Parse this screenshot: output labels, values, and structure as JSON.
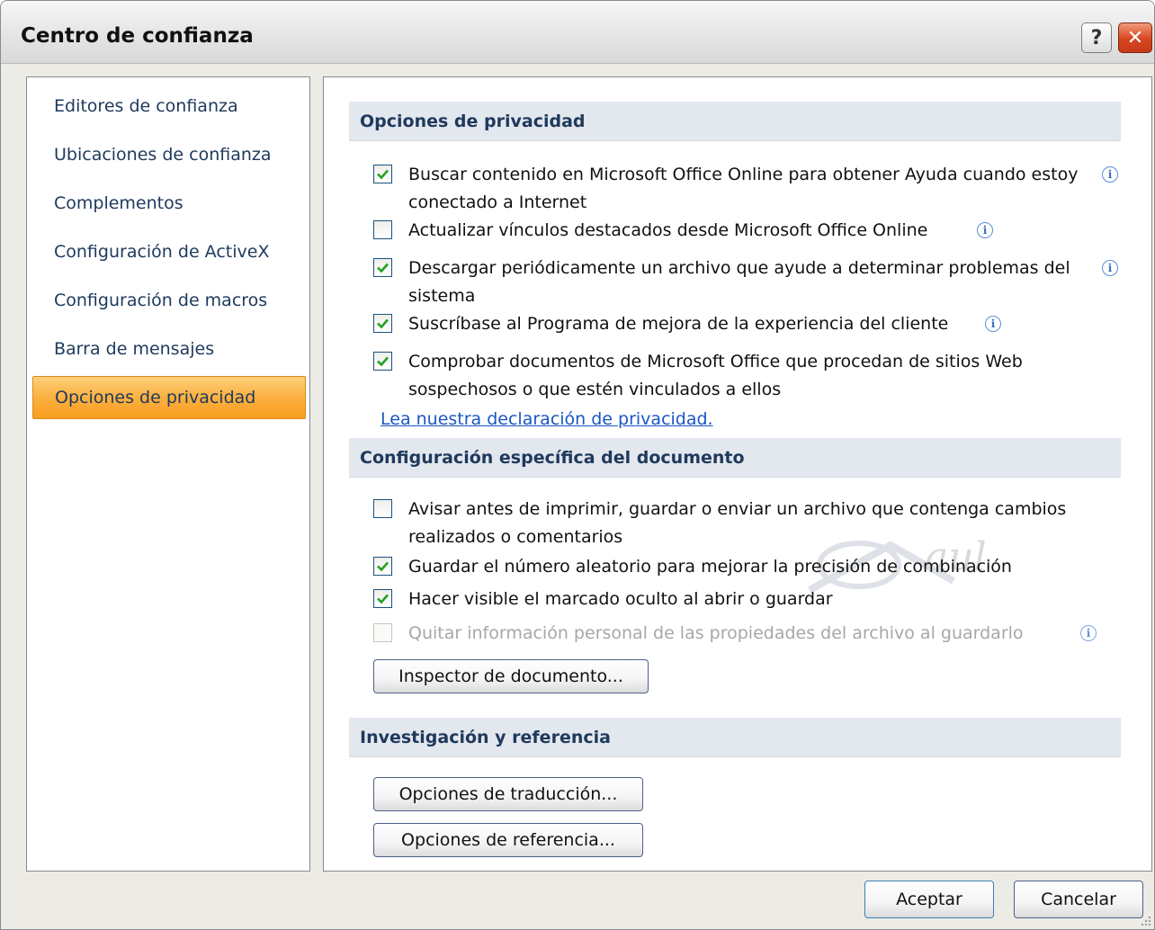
{
  "window": {
    "title": "Centro de confianza",
    "help_label": "?",
    "close_label": "✕"
  },
  "nav": {
    "items": [
      {
        "label": "Editores de confianza",
        "selected": false
      },
      {
        "label": "Ubicaciones de confianza",
        "selected": false
      },
      {
        "label": "Complementos",
        "selected": false
      },
      {
        "label": "Configuración de ActiveX",
        "selected": false
      },
      {
        "label": "Configuración de macros",
        "selected": false
      },
      {
        "label": "Barra de mensajes",
        "selected": false
      },
      {
        "label": "Opciones de privacidad",
        "selected": true
      }
    ]
  },
  "privacy": {
    "header": "Opciones de privacidad",
    "options": [
      {
        "label": "Buscar contenido en Microsoft Office Online para obtener Ayuda cuando estoy conectado a Internet",
        "checked": true,
        "disabled": false,
        "has_info": true
      },
      {
        "label": "Actualizar vínculos destacados desde Microsoft Office Online",
        "checked": false,
        "disabled": false,
        "has_info": true
      },
      {
        "label": "Descargar periódicamente un archivo que ayude a determinar problemas del sistema",
        "checked": true,
        "disabled": false,
        "has_info": true
      },
      {
        "label": "Suscríbase al Programa de mejora de la experiencia del cliente",
        "checked": true,
        "disabled": false,
        "has_info": true
      },
      {
        "label": "Comprobar documentos de Microsoft Office que procedan de sitios Web sospechosos o que estén vinculados a ellos",
        "checked": true,
        "disabled": false,
        "has_info": false
      }
    ],
    "link": "Lea nuestra declaración de privacidad."
  },
  "document": {
    "header": "Configuración específica del documento",
    "options": [
      {
        "label": "Avisar antes de imprimir, guardar o enviar un archivo que contenga cambios realizados o comentarios",
        "checked": false,
        "disabled": false,
        "has_info": false
      },
      {
        "label": "Guardar el número aleatorio para mejorar la precisión de combinación",
        "checked": true,
        "disabled": false,
        "has_info": false
      },
      {
        "label": "Hacer visible el marcado oculto al abrir o guardar",
        "checked": true,
        "disabled": false,
        "has_info": false
      },
      {
        "label": "Quitar información personal de las propiedades del archivo al guardarlo",
        "checked": false,
        "disabled": true,
        "has_info": true
      }
    ],
    "inspector_button": "Inspector de documento..."
  },
  "research": {
    "header": "Investigación y referencia",
    "translation_button": "Opciones de traducción...",
    "reference_button": "Opciones de referencia..."
  },
  "footer": {
    "ok_button": "Aceptar",
    "cancel_button": "Cancelar"
  },
  "watermark_text": "aula clic",
  "icons": {
    "info": "info-icon",
    "check": "checkmark-icon",
    "help": "help-icon",
    "close": "close-icon"
  },
  "colors": {
    "selected_nav": "#fbb041",
    "link": "#1b56c4",
    "section_header_bg": "#e3e7ee",
    "close_button": "#d6461f"
  }
}
